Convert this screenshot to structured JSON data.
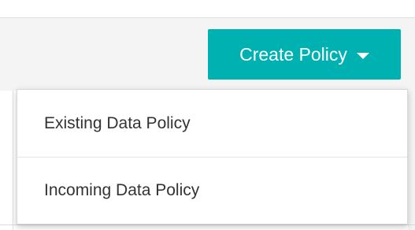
{
  "toolbar": {
    "create_policy_label": "Create Policy",
    "create_policy_icon": "caret-down-icon",
    "accent_color": "#00b1b2"
  },
  "dropdown": {
    "items": [
      {
        "label": "Existing Data Policy"
      },
      {
        "label": "Incoming Data Policy"
      }
    ]
  }
}
